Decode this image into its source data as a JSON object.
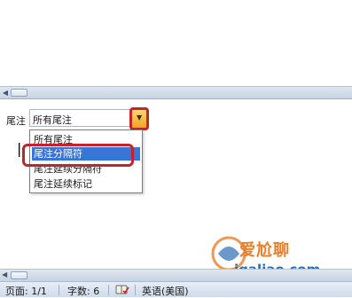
{
  "footnote_pane": {
    "label": "尾注",
    "selected_value": "所有尾注",
    "dropdown_items": [
      "所有尾注",
      "尾注分隔符",
      "尾注延续分隔符",
      "尾注延续标记"
    ],
    "highlighted_index": 1
  },
  "watermark": {
    "line1": "爱尬聊",
    "line2": "igaliao.com"
  },
  "status_bar": {
    "page": "页面: 1/1",
    "word_count": "字数: 6",
    "language": "英语(美国)"
  },
  "colors": {
    "accent_red": "#c2242b",
    "selection_blue": "#3875d7",
    "combo_button": "#f3a224"
  },
  "icons": {
    "scroll_left": "triangle-left-icon",
    "dropdown": "chevron-down-icon",
    "spellcheck": "book-check-icon"
  }
}
